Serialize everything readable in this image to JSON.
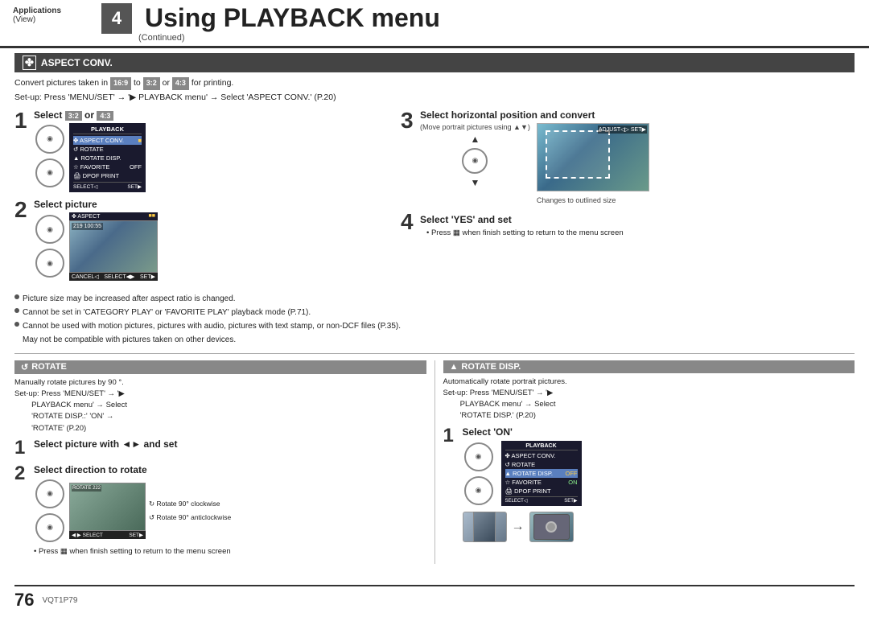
{
  "header": {
    "category": "Applications",
    "category_sub": "(View)",
    "number": "4",
    "title": "Using PLAYBACK menu",
    "subtitle": "(Continued)"
  },
  "aspect_conv": {
    "section_title": "ASPECT CONV.",
    "intro1": "Convert pictures taken in 16:9 to 3:2 or 4:3 for printing.",
    "intro2": "Set-up: Press 'MENU/SET' → '▶ PLAYBACK menu' → Select 'ASPECT CONV.' (P.20)",
    "step1_title": "Select 3:2 or 4:3",
    "step2_title": "Select picture",
    "step3_title": "Select horizontal position and convert",
    "step3_note": "(Move portrait pictures using ▲▼)",
    "step3_sub": "Changes to outlined size",
    "step4_title": "Select 'YES' and set",
    "step4_note1": "• Press ▦ when finish setting to return to the menu screen",
    "notes": [
      "Picture size may be increased after aspect ratio is changed.",
      "Cannot be set in 'CATEGORY PLAY' or 'FAVORITE PLAY' playback mode (P.71).",
      "Cannot be used with motion pictures, pictures with audio, pictures with text stamp, or non-DCF files (P.35).",
      "May not be compatible with pictures taken on other devices."
    ]
  },
  "rotate": {
    "section_title": "ROTATE",
    "rotate_icon": "↺",
    "intro1": "Manually rotate pictures by 90 °.",
    "setup": "Set-up: Press 'MENU/SET' → '▶ PLAYBACK menu' → Select 'ROTATE DISP.:' 'ON' → 'ROTATE' (P.20)",
    "step1_title": "Select picture with ◄► and set",
    "step2_title": "Select direction to rotate",
    "rotate90cw": "Rotate 90° clockwise",
    "rotate90ccw": "Rotate 90° anticlockwise",
    "note": "• Press ▦ when finish setting to return to the menu screen"
  },
  "rotate_disp": {
    "section_title": "ROTATE DISP.",
    "rotate_disp_icon": "▲",
    "intro1": "Automatically rotate portrait pictures.",
    "setup": "Set-up: Press 'MENU/SET' → '▶ PLAYBACK menu' → Select 'ROTATE DISP.' (P.20)",
    "step1_title": "Select 'ON'"
  },
  "footer": {
    "page": "76",
    "code": "VQT1P79"
  },
  "menu_items": {
    "playback_label": "PLAYBACK",
    "aspect_conv": "ASPECT CONV.",
    "rotate": "ROTATE",
    "rotate_disp": "ROTATE DISP.",
    "favorite": "FAVORITE",
    "dpof_print": "DPOF PRINT",
    "select_label": "SELECT◁",
    "set_label": "SET▶"
  }
}
